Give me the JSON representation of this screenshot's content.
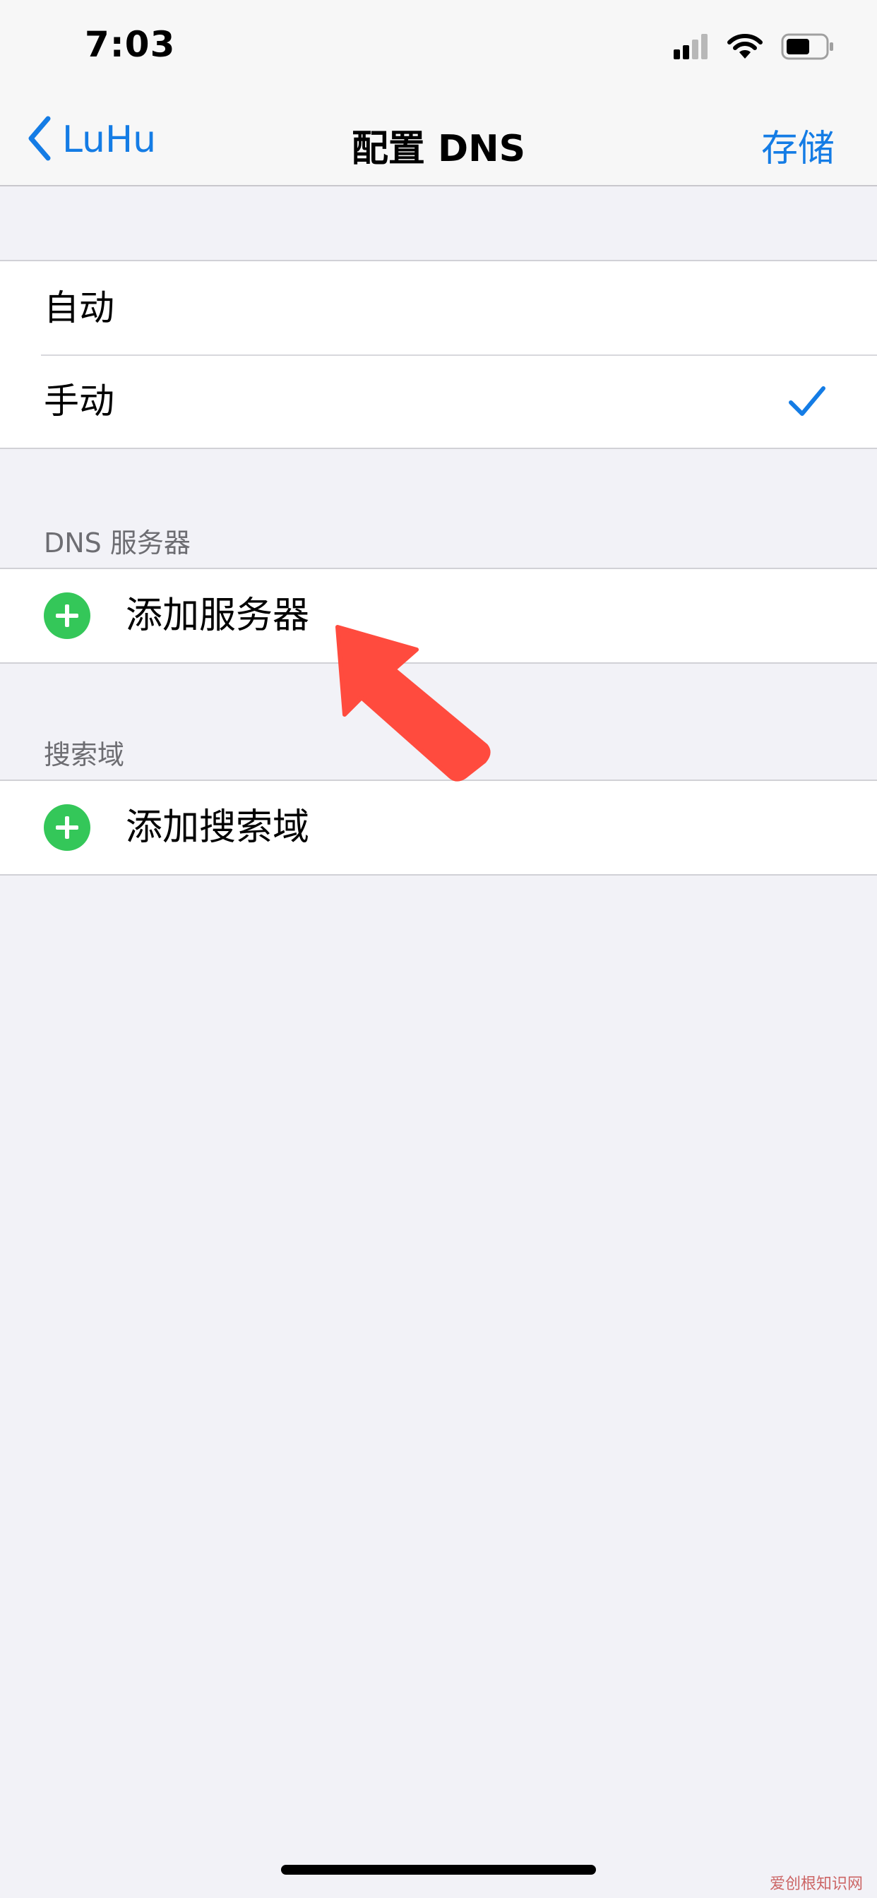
{
  "status_bar": {
    "time": "7:03"
  },
  "nav": {
    "back_label": "LuHu",
    "title": "配置 DNS",
    "save_label": "存储"
  },
  "mode_group": {
    "items": [
      {
        "label": "自动",
        "selected": false
      },
      {
        "label": "手动",
        "selected": true
      }
    ]
  },
  "dns_servers": {
    "header": "DNS 服务器",
    "add_label": "添加服务器"
  },
  "search_domains": {
    "header": "搜索域",
    "add_label": "添加搜索域"
  },
  "watermark": "爱创根知识网",
  "colors": {
    "accent": "#147ce5",
    "add_green": "#34c759",
    "arrow_red": "#ff4b3e",
    "background": "#f2f2f7"
  },
  "icons": {
    "back": "chevron-left-icon",
    "check": "checkmark-icon",
    "add": "plus-circle-icon",
    "signal": "cellular-signal-icon",
    "wifi": "wifi-icon",
    "battery": "battery-icon",
    "annotation": "red-arrow-icon"
  }
}
